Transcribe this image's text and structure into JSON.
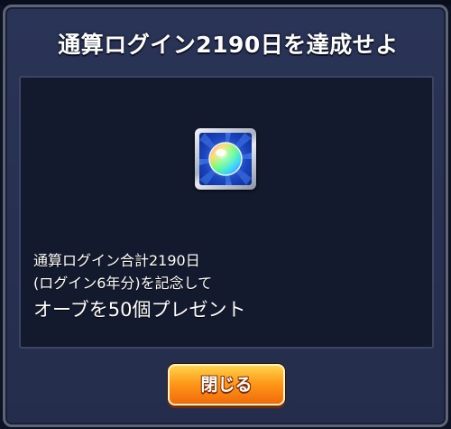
{
  "dialog": {
    "title": "通算ログイン2190日を達成せよ",
    "message": {
      "line1": "通算ログイン合計2190日",
      "line2": "(ログイン6年分)を記念して",
      "line3": "オーブを50個プレゼント"
    },
    "reward": {
      "icon": "orb-icon",
      "quantity": 50
    },
    "close_label": "閉じる"
  },
  "colors": {
    "panel": "#2a3456",
    "content_bg": "#141a2e",
    "button_top": "#ffd34a",
    "button_bottom": "#f06a0a",
    "reward_bg": "#1b47c9"
  }
}
